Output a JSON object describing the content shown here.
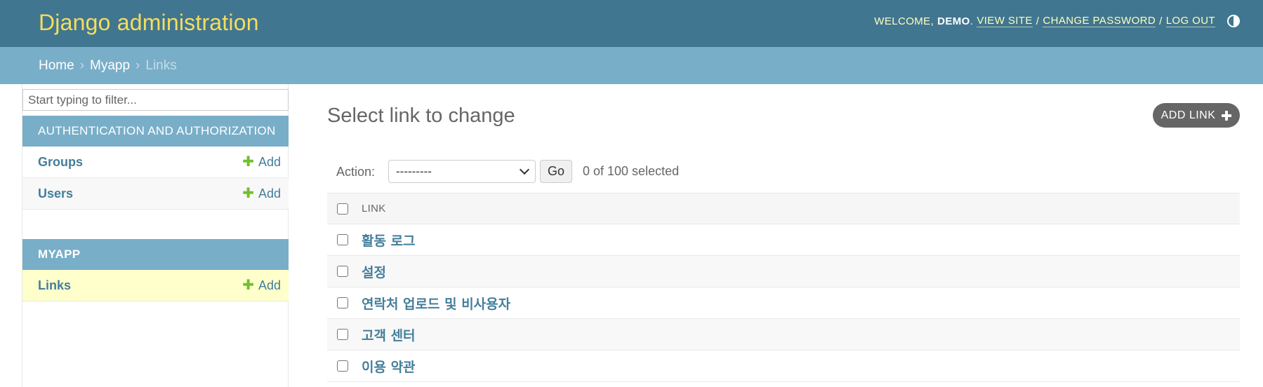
{
  "header": {
    "site_title": "Django administration",
    "welcome_text": "WELCOME,",
    "username": "DEMO",
    "username_suffix": ".",
    "view_site": "VIEW SITE",
    "change_password": "CHANGE PASSWORD",
    "logout": "LOG OUT",
    "separator": "/",
    "theme_toggle_icon": "contrast-icon"
  },
  "breadcrumbs": {
    "items": [
      "Home",
      "Myapp"
    ],
    "current": "Links",
    "separator": "›"
  },
  "sidebar": {
    "filter_placeholder": "Start typing to filter...",
    "modules": [
      {
        "caption": "AUTHENTICATION AND AUTHORIZATION",
        "models": [
          {
            "name": "Groups",
            "add_label": "Add"
          },
          {
            "name": "Users",
            "add_label": "Add"
          }
        ]
      },
      {
        "caption": "MYAPP",
        "models": [
          {
            "name": "Links",
            "add_label": "Add",
            "current": true
          }
        ]
      }
    ]
  },
  "content": {
    "title": "Select link to change",
    "add_button": "ADD LINK",
    "action_label": "Action:",
    "action_selected": "---------",
    "go_label": "Go",
    "counter": "0 of 100 selected",
    "column_header": "LINK",
    "rows": [
      "활동 로그",
      "설정",
      "연락처 업로드 및 비사용자",
      "고객 센터",
      "이용 약관"
    ]
  },
  "colors": {
    "header_bg": "#417690",
    "branding": "#f5dd5d",
    "breadcrumbs_bg": "#79aec8",
    "link": "#447e9b",
    "add_green": "#70bf2b",
    "current_row": "#ffffcc"
  }
}
